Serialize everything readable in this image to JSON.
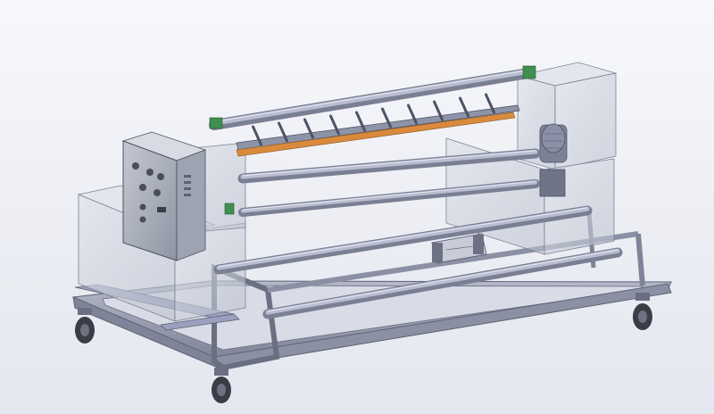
{
  "scene": {
    "subject": "roll-slitting-rewinding-machine",
    "colors": {
      "background_top": "#f7f8fb",
      "background_bottom": "#e4e7ef",
      "steel": "#9a9fb3",
      "steel_dark": "#5d6275",
      "roller": "#a9aec4",
      "roller_highlight": "#d7dae6",
      "housing_glass": "#c8cdd8",
      "panel": "#aeb3bf",
      "knife_bar": "#d98a3c",
      "bearing_green": "#3f8f4f",
      "wheel": "#3a3d47"
    },
    "knife_count": 10
  }
}
